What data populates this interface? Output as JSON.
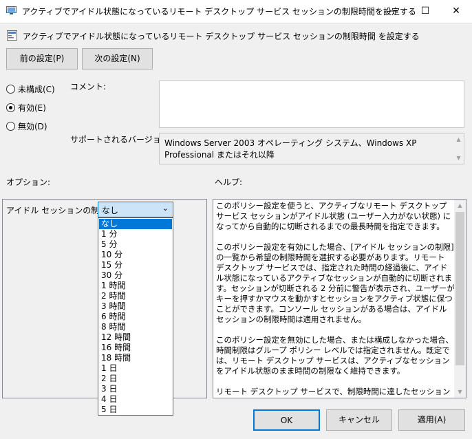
{
  "window": {
    "title": "アクティブでアイドル状態になっているリモート デスクトップ サービス セッションの制限時間を設定する",
    "controls": {
      "minimize": "—",
      "maximize": "☐",
      "close": "✕"
    }
  },
  "header": {
    "icon": "policy-settings-icon",
    "text": "アクティブでアイドル状態になっているリモート デスクトップ サービス セッションの制限時間 を設定する"
  },
  "nav": {
    "prev_label": "前の設定(P)",
    "next_label": "次の設定(N)"
  },
  "state": {
    "options": [
      {
        "label": "未構成(C)",
        "checked": false
      },
      {
        "label": "有効(E)",
        "checked": true
      },
      {
        "label": "無効(D)",
        "checked": false
      }
    ]
  },
  "comment": {
    "label": "コメント:",
    "value": ""
  },
  "supported": {
    "label": "サポートされるバージョン:",
    "value": "Windows Server 2003 オペレーティング システム、Windows XP Professional またはそれ以降"
  },
  "options_section": {
    "label": "オプション:",
    "idle_limit_label": "アイドル セッションの制限:",
    "selected": "なし",
    "items": [
      "なし",
      "1 分",
      "5 分",
      "10 分",
      "15 分",
      "30 分",
      "1 時間",
      "2 時間",
      "3 時間",
      "6 時間",
      "8 時間",
      "12 時間",
      "16 時間",
      "18 時間",
      "1 日",
      "2 日",
      "3 日",
      "4 日",
      "5 日"
    ]
  },
  "help_section": {
    "label": "ヘルプ:",
    "paragraphs": [
      "このポリシー設定を使うと、アクティブなリモート デスクトップ サービス セッションがアイドル状態 (ユーザー入力がない状態) になってから自動的に切断されるまでの最長時間を指定できます。",
      "このポリシー設定を有効にした場合、[アイドル セッションの制限] の一覧から希望の制限時間を選択する必要があります。リモート デスクトップ サービスでは、指定された時間の経過後に、アイドル状態になっているアクティブなセッションが自動的に切断されます。セッションが切断される 2 分前に警告が表示され、ユーザーがキーを押すかマウスを動かすとセッションをアクティブ状態に保つことができます。コンソール セッションがある場合は、アイドル セッションの制限時間は適用されません。",
      "このポリシー設定を無効にした場合、または構成しなかった場合、時間制限はグループ ポリシー レベルでは指定されません。既定では、リモート デスクトップ サービスは、アクティブなセッションをアイドル状態のまま時間の制限なく維持できます。",
      "リモート デスクトップ サービスで、制限時間に達したセッションを切断する代わりに終了させるには、\"コンピューターの構成¥管理用テンプレート"
    ]
  },
  "footer": {
    "ok_label": "OK",
    "cancel_label": "キャンセル",
    "apply_label": "適用(A)"
  }
}
